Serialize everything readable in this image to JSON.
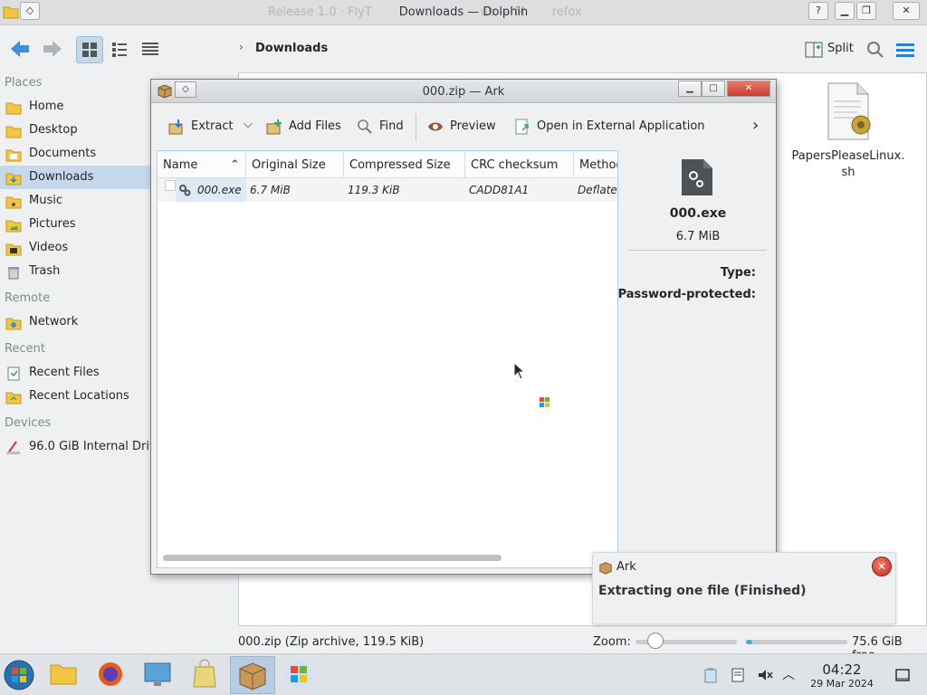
{
  "dolphin": {
    "title": "Downloads — Dolphin",
    "ghost_title": "Release 1.0 · FlyT",
    "ghost_title_2": "ub — M",
    "ghost_title_3": "refox",
    "help_button": "?",
    "breadcrumb": "Downloads",
    "split_label": "Split",
    "sidebar": {
      "places_title": "Places",
      "places": [
        {
          "label": "Home",
          "icon": "home-folder-icon"
        },
        {
          "label": "Desktop",
          "icon": "desktop-folder-icon"
        },
        {
          "label": "Documents",
          "icon": "documents-folder-icon"
        },
        {
          "label": "Downloads",
          "icon": "downloads-folder-icon",
          "active": true
        },
        {
          "label": "Music",
          "icon": "music-folder-icon"
        },
        {
          "label": "Pictures",
          "icon": "pictures-folder-icon"
        },
        {
          "label": "Videos",
          "icon": "videos-folder-icon"
        },
        {
          "label": "Trash",
          "icon": "trash-icon"
        }
      ],
      "remote_title": "Remote",
      "remote": [
        {
          "label": "Network",
          "icon": "network-folder-icon"
        }
      ],
      "recent_title": "Recent",
      "recent": [
        {
          "label": "Recent Files",
          "icon": "recent-files-icon"
        },
        {
          "label": "Recent Locations",
          "icon": "recent-locations-icon"
        }
      ],
      "devices_title": "Devices",
      "devices": [
        {
          "label": "96.0 GiB Internal Drive",
          "icon": "drive-icon"
        }
      ]
    },
    "desktop_file": {
      "name_line1": "PapersPleaseLinux.",
      "name_line2": "sh",
      "icon": "shell-script-icon"
    },
    "status": "000.zip (Zip archive, 119.5 KiB)",
    "zoom_label": "Zoom:",
    "free_space": "75.6 GiB free",
    "zoom_level_fraction": 0.2,
    "disk_used_fraction": 0.06
  },
  "ark": {
    "title": "000.zip — Ark",
    "window_buttons": {
      "minimize": "▁",
      "maximize": "□",
      "close": "✕"
    },
    "toolbar": {
      "extract": "Extract",
      "add_files": "Add Files",
      "find": "Find",
      "preview": "Preview",
      "open_external": "Open in External Application"
    },
    "columns": [
      "Name",
      "Original Size",
      "Compressed Size",
      "CRC checksum",
      "Method"
    ],
    "rows": [
      {
        "name": "000.exe",
        "original_size": "6.7 MiB",
        "compressed_size": "119.3 KiB",
        "crc": "CADD81A1",
        "method": "Deflate"
      }
    ],
    "details": {
      "name": "000.exe",
      "size": "6.7 MiB",
      "type_label": "Type:",
      "password_label": "Password-protected:"
    }
  },
  "notification": {
    "app": "Ark",
    "message": "Extracting one file (Finished)"
  },
  "taskbar": {
    "time": "04:22",
    "date": "29 Mar 2024"
  },
  "colors": {
    "selection": "#c6d9ec",
    "accent": "#3daee9",
    "close_red": "#c52c1e"
  }
}
